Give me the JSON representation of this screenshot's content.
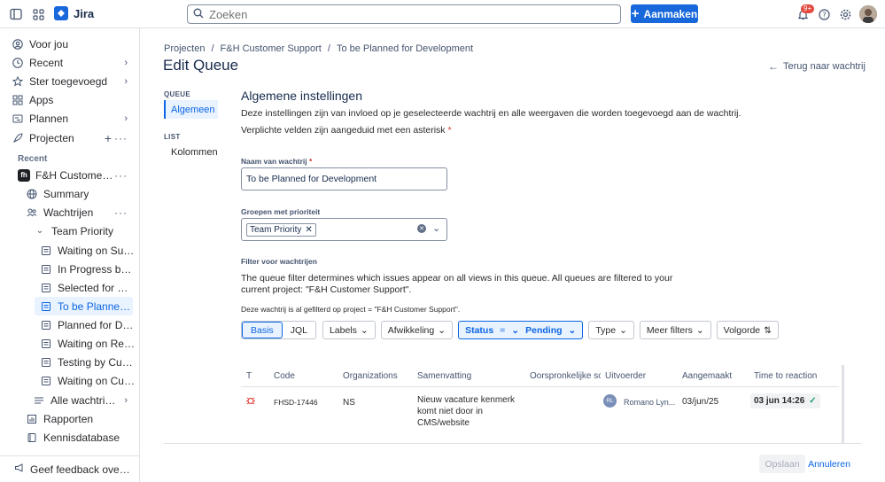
{
  "topbar": {
    "app_name": "Jira",
    "search_placeholder": "Zoeken",
    "create_label": "Aanmaken",
    "notification_count": "9+"
  },
  "sidebar": {
    "items": [
      {
        "label": "Voor jou",
        "icon": "user-circle-icon"
      },
      {
        "label": "Recent",
        "icon": "clock-icon"
      },
      {
        "label": "Ster toegevoegd",
        "icon": "star-icon"
      },
      {
        "label": "Apps",
        "icon": "apps-icon"
      },
      {
        "label": "Plannen",
        "icon": "plan-icon"
      },
      {
        "label": "Projecten",
        "icon": "rocket-icon"
      }
    ],
    "recent_heading": "Recent",
    "project": {
      "label": "F&H Customer Support",
      "avatar": "fh"
    },
    "project_items": [
      {
        "label": "Summary",
        "icon": "globe-icon"
      },
      {
        "label": "Wachtrijen",
        "icon": "people-icon"
      }
    ],
    "group": "Team Priority",
    "queues": [
      "Waiting on Support",
      "In Progress by Support",
      "Selected for Development",
      "To be Planned for Development",
      "Planned for Development",
      "Waiting on Review",
      "Testing by Customer",
      "Waiting on Customer"
    ],
    "all_queues": "Alle wachtrijen",
    "reports": "Rapporten",
    "knowledge": "Kennisdatabase",
    "feedback": "Geef feedback over de nieuwe navigatie"
  },
  "breadcrumb": [
    "Projecten",
    "F&H Customer Support",
    "To be Planned for Development"
  ],
  "page_title": "Edit Queue",
  "back_label": "Terug naar wachtrij",
  "left_nav": {
    "queue_heading": "QUEUE",
    "queue_item": "Algemeen",
    "list_heading": "LIST",
    "list_item": "Kolommen"
  },
  "form": {
    "heading": "Algemene instellingen",
    "desc1": "Deze instellingen zijn van invloed op je geselecteerde wachtrij en alle weergaven die worden toegevoegd aan de wachtrij.",
    "desc2": "Verplichte velden zijn aangeduid met een asterisk",
    "name_label": "Naam van wachtrij",
    "name_value": "To be Planned for Development",
    "priority_label": "Groepen met prioriteit",
    "priority_tag": "Team Priority",
    "filter_label": "Filter voor wachtrijen",
    "filter_desc1": "The queue filter determines which issues appear on all views in this queue. All queues are filtered to your",
    "filter_desc2": "current project: \"F&H Customer Support\".",
    "filter_note": "Deze wachtrij is al gefilterd op project = \"F&H Customer Support\"."
  },
  "filterbar": {
    "basis": "Basis",
    "jql": "JQL",
    "labels": "Labels",
    "afwikkeling": "Afwikkeling",
    "status": "Status",
    "status_op": "=",
    "status_value": "Pending",
    "type": "Type",
    "meer": "Meer filters",
    "volgorde": "Volgorde"
  },
  "table": {
    "headers": [
      "T",
      "Code",
      "Organizations",
      "Samenvatting",
      "Oorspronkelijke sc",
      "Uitvoerder",
      "Aangemaakt",
      "Time to reaction"
    ],
    "row": {
      "code": "FHSD-17446",
      "org": "NS",
      "summary1": "Nieuw vacature kenmerk",
      "summary2": "komt niet door in",
      "summary3": "CMS/website",
      "assignee_initials": "RL",
      "assignee": "Romano Lyn...",
      "created": "03/jun/25",
      "ttr": "03 jun 14:26"
    }
  },
  "footer": {
    "save": "Opslaan",
    "cancel": "Annuleren"
  },
  "colors": {
    "accent": "#1868db",
    "link": "#0c66e4",
    "required": "#c9372c",
    "bug": "#e2483d"
  }
}
